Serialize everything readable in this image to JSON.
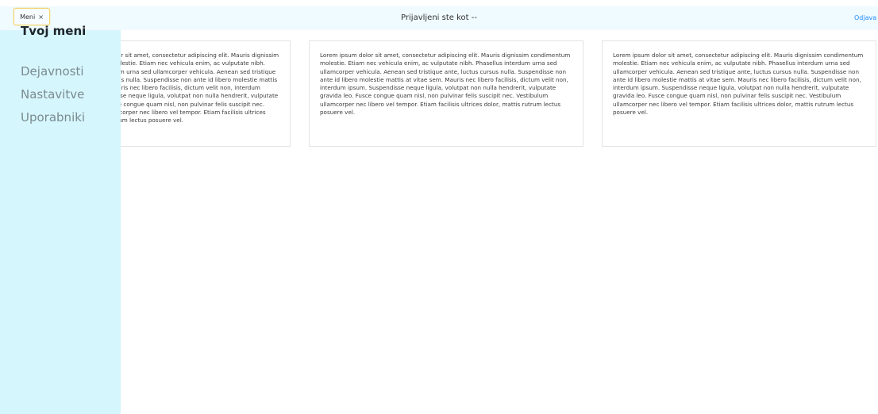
{
  "topbar": {
    "menu_label": "Meni",
    "close_glyph": "×",
    "title": "Prijavljeni ste kot --",
    "logout_label": "Odjava"
  },
  "sidebar": {
    "items": [
      {
        "label": "Tvoj meni",
        "active": true
      },
      {
        "label": "Dejavnosti",
        "active": false
      },
      {
        "label": "Nastavitve",
        "active": false
      },
      {
        "label": "Uporabniki",
        "active": false
      }
    ]
  },
  "cards": [
    {
      "text": "Lorem ipsum dolor sit amet, consectetur adipiscing elit. Mauris dignissim condimentum molestie. Etiam nec vehicula enim, ac vulputate nibh. Phasellus interdum urna sed ullamcorper vehicula. Aenean sed tristique ante, luctus cursus nulla. Suspendisse non ante id libero molestie mattis at vitae sem. Mauris nec libero facilisis, dictum velit non, interdum ipsum. Suspendisse neque ligula, volutpat non nulla hendrerit, vulputate gravida leo. Fusce congue quam nisl, non pulvinar felis suscipit nec. Vestibulum ullamcorper nec libero vel tempor. Etiam facilisis ultrices dolor, mattis rutrum lectus posuere vel."
    },
    {
      "text": "Lorem ipsum dolor sit amet, consectetur adipiscing elit. Mauris dignissim condimentum molestie. Etiam nec vehicula enim, ac vulputate nibh. Phasellus interdum urna sed ullamcorper vehicula. Aenean sed tristique ante, luctus cursus nulla. Suspendisse non ante id libero molestie mattis at vitae sem. Mauris nec libero facilisis, dictum velit non, interdum ipsum. Suspendisse neque ligula, volutpat non nulla hendrerit, vulputate gravida leo. Fusce congue quam nisl, non pulvinar felis suscipit nec. Vestibulum ullamcorper nec libero vel tempor. Etiam facilisis ultrices dolor, mattis rutrum lectus posuere vel."
    },
    {
      "text": "Lorem ipsum dolor sit amet, consectetur adipiscing elit. Mauris dignissim condimentum molestie. Etiam nec vehicula enim, ac vulputate nibh. Phasellus interdum urna sed ullamcorper vehicula. Aenean sed tristique ante, luctus cursus nulla. Suspendisse non ante id libero molestie mattis at vitae sem. Mauris nec libero facilisis, dictum velit non, interdum ipsum. Suspendisse neque ligula, volutpat non nulla hendrerit, vulputate gravida leo. Fusce congue quam nisl, non pulvinar felis suscipit nec. Vestibulum ullamcorper nec libero vel tempor. Etiam facilisis ultrices dolor, mattis rutrum lectus posuere vel."
    }
  ],
  "colors": {
    "topbar_bg": "#f0fbff",
    "sidebar_bg": "#d6f6fd",
    "menu_button_border": "#f3d36b",
    "logout_link": "#1e8bff"
  }
}
